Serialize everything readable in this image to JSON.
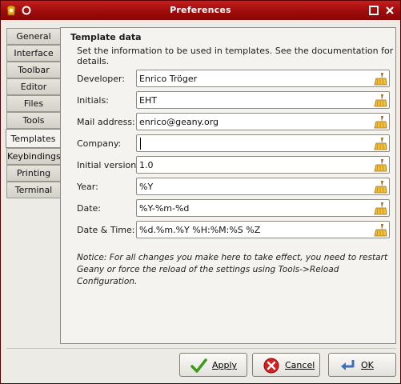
{
  "window": {
    "title": "Preferences"
  },
  "tabs": [
    {
      "label": "General"
    },
    {
      "label": "Interface"
    },
    {
      "label": "Toolbar"
    },
    {
      "label": "Editor"
    },
    {
      "label": "Files"
    },
    {
      "label": "Tools"
    },
    {
      "label": "Templates",
      "active": true
    },
    {
      "label": "Keybindings"
    },
    {
      "label": "Printing"
    },
    {
      "label": "Terminal"
    }
  ],
  "section": {
    "title": "Template data",
    "description": "Set the information to be used in templates. See the documentation for details."
  },
  "fields": [
    {
      "label": "Developer:",
      "value": "Enrico Tröger"
    },
    {
      "label": "Initials:",
      "value": "EHT"
    },
    {
      "label": "Mail address:",
      "value": "enrico@geany.org"
    },
    {
      "label": "Company:",
      "value": ""
    },
    {
      "label": "Initial version:",
      "value": "1.0"
    },
    {
      "label": "Year:",
      "value": "%Y"
    },
    {
      "label": "Date:",
      "value": "%Y-%m-%d"
    },
    {
      "label": "Date & Time:",
      "value": "%d.%m.%Y %H:%M:%S %Z"
    }
  ],
  "notice": "Notice: For all changes you make here to take effect, you need to restart Geany or force the reload of the settings using Tools->Reload Configuration.",
  "buttons": {
    "apply": "Apply",
    "cancel": "Cancel",
    "ok": "OK"
  },
  "icons": {
    "app": "geany-icon",
    "field_clear": "broom-icon",
    "apply": "checkmark-icon",
    "cancel": "cancel-icon",
    "ok": "return-arrow-icon"
  },
  "colors": {
    "titlebar": "#a81212",
    "window_bg": "#ecebe6"
  }
}
